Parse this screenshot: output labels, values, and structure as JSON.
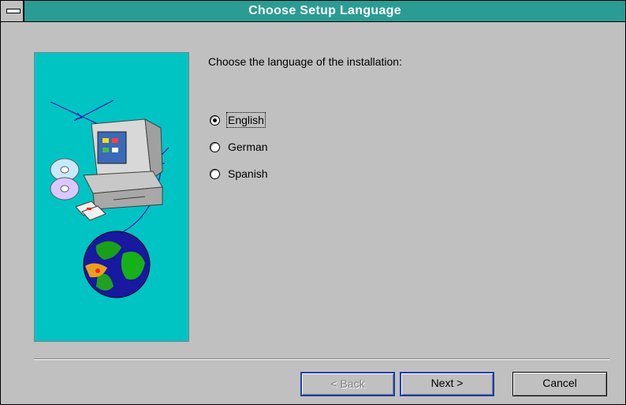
{
  "window": {
    "title": "Choose Setup Language"
  },
  "content": {
    "prompt": "Choose the language of the installation:",
    "languages": [
      {
        "label": "English",
        "selected": true
      },
      {
        "label": "German",
        "selected": false
      },
      {
        "label": "Spanish",
        "selected": false
      }
    ]
  },
  "buttons": {
    "back": "< Back",
    "next": "Next >",
    "cancel": "Cancel"
  },
  "colors": {
    "titlebar": "#2a9c94",
    "art_background": "#00c4c4",
    "dialog": "#c0c0c0"
  },
  "icons": [
    "system-menu-icon",
    "computer-icon",
    "cd-icon",
    "floppy-icon",
    "globe-icon"
  ]
}
